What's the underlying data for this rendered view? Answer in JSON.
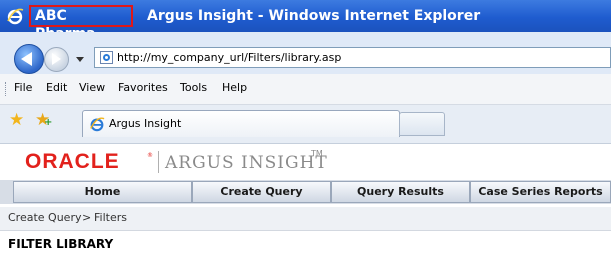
{
  "window": {
    "company": "ABC Pharma",
    "title": "Argus Insight - Windows Internet Explorer",
    "icon": "internet-explorer-icon"
  },
  "address_bar": {
    "url": "http://my_company_url/Filters/library.asp"
  },
  "menu": {
    "items": [
      "File",
      "Edit",
      "View",
      "Favorites",
      "Tools",
      "Help"
    ]
  },
  "browser_tab": {
    "title": "Argus Insight"
  },
  "branding": {
    "oracle": "ORACLE",
    "registered": "®",
    "product": "ARGUS INSIGHT",
    "trademark": "TM",
    "oracle_color": "#e2211c"
  },
  "nav": {
    "tabs": [
      "Home",
      "Create Query",
      "Query Results",
      "Case Series Reports"
    ]
  },
  "breadcrumb": {
    "parent": "Create Query",
    "separator": ">",
    "current": "Filters"
  },
  "page": {
    "heading": "FILTER LIBRARY"
  }
}
